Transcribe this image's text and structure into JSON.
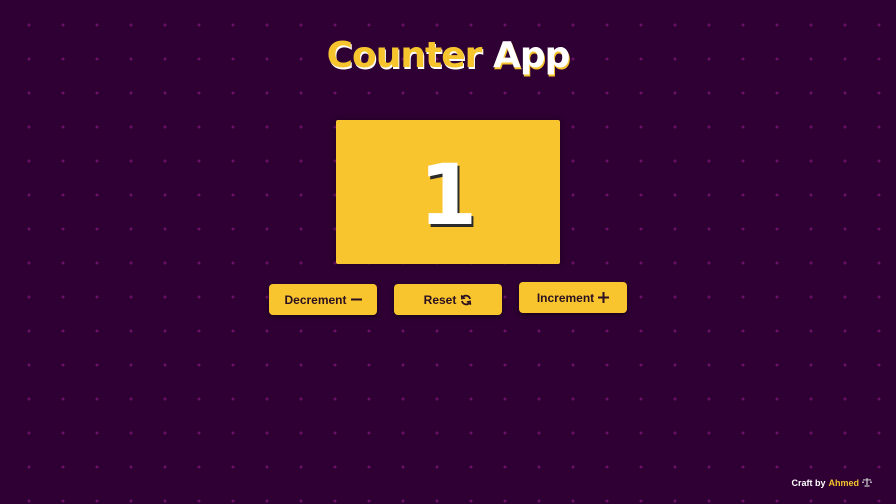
{
  "header": {
    "title_part_1": "Counter",
    "title_part_2": "App"
  },
  "counter": {
    "value": "1"
  },
  "buttons": {
    "decrement_label": "Decrement",
    "reset_label": "Reset",
    "increment_label": "Increment"
  },
  "icons": {
    "decrement": "minus-icon",
    "reset": "refresh-icon",
    "increment": "plus-icon",
    "footer": "scale-icon"
  },
  "footer": {
    "prefix": "Craft by",
    "author": "Ahmed"
  },
  "colors": {
    "background": "#2e0033",
    "accent": "#f8c52f",
    "text_light": "#ffffff",
    "button_text": "#2a1020"
  }
}
